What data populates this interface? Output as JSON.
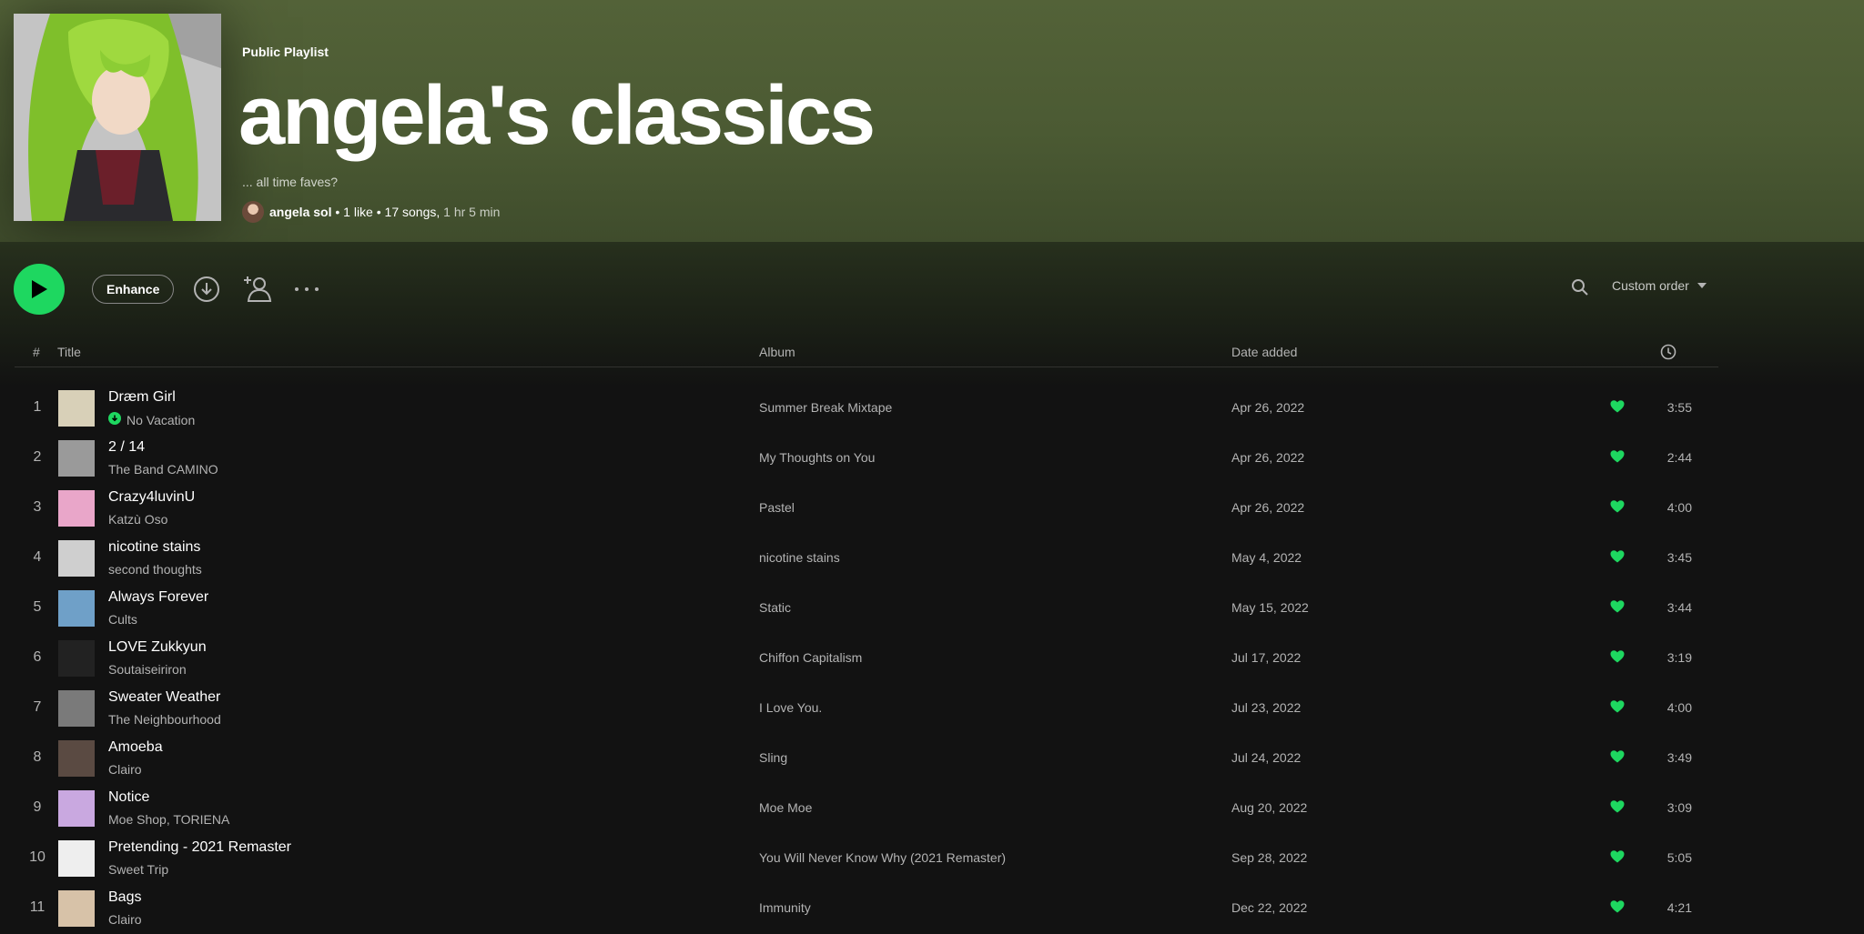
{
  "playlist": {
    "type_label": "Public Playlist",
    "title": "angela's classics",
    "description": "... all time faves?",
    "owner": "angela sol",
    "likes": "1 like",
    "songs": "17 songs,",
    "duration": "1 hr 5 min"
  },
  "actions": {
    "enhance_label": "Enhance",
    "sort_label": "Custom order"
  },
  "columns": {
    "number": "#",
    "title": "Title",
    "album": "Album",
    "date_added": "Date added"
  },
  "colors": {
    "accent": "#1ed760",
    "header_bg": "#536238",
    "page_bg": "#121212"
  },
  "tracks": [
    {
      "num": "1",
      "title": "Dræm Girl",
      "artist": "No Vacation",
      "album": "Summer Break Mixtape",
      "date": "Apr 26, 2022",
      "duration": "3:55",
      "thumb_color": "#d8d0b8"
    },
    {
      "num": "2",
      "title": "2 / 14",
      "artist": "The Band CAMINO",
      "album": "My Thoughts on You",
      "date": "Apr 26, 2022",
      "duration": "2:44",
      "thumb_color": "#9a9a9a"
    },
    {
      "num": "3",
      "title": "Crazy4luvinU",
      "artist": "Katzù Oso",
      "album": "Pastel",
      "date": "Apr 26, 2022",
      "duration": "4:00",
      "thumb_color": "#e9a6c9"
    },
    {
      "num": "4",
      "title": "nicotine stains",
      "artist": "second thoughts",
      "album": "nicotine stains",
      "date": "May 4, 2022",
      "duration": "3:45",
      "thumb_color": "#cfcfcf"
    },
    {
      "num": "5",
      "title": "Always Forever",
      "artist": "Cults",
      "album": "Static",
      "date": "May 15, 2022",
      "duration": "3:44",
      "thumb_color": "#6fa0c8"
    },
    {
      "num": "6",
      "title": "LOVE Zukkyun",
      "artist": "Soutaiseiriron",
      "album": "Chiffon Capitalism",
      "date": "Jul 17, 2022",
      "duration": "3:19",
      "thumb_color": "#222222"
    },
    {
      "num": "7",
      "title": "Sweater Weather",
      "artist": "The Neighbourhood",
      "album": "I Love You.",
      "date": "Jul 23, 2022",
      "duration": "4:00",
      "thumb_color": "#7a7a7a"
    },
    {
      "num": "8",
      "title": "Amoeba",
      "artist": "Clairo",
      "album": "Sling",
      "date": "Jul 24, 2022",
      "duration": "3:49",
      "thumb_color": "#5a4a42"
    },
    {
      "num": "9",
      "title": "Notice",
      "artist": "Moe Shop, TORIENA",
      "album": "Moe Moe",
      "date": "Aug 20, 2022",
      "duration": "3:09",
      "thumb_color": "#c9a8e0"
    },
    {
      "num": "10",
      "title": "Pretending - 2021 Remaster",
      "artist": "Sweet Trip",
      "album": "You Will Never Know Why (2021 Remaster)",
      "date": "Sep 28, 2022",
      "duration": "5:05",
      "thumb_color": "#eeeeee"
    },
    {
      "num": "11",
      "title": "Bags",
      "artist": "Clairo",
      "album": "Immunity",
      "date": "Dec 22, 2022",
      "duration": "4:21",
      "thumb_color": "#d7c2a8"
    }
  ]
}
